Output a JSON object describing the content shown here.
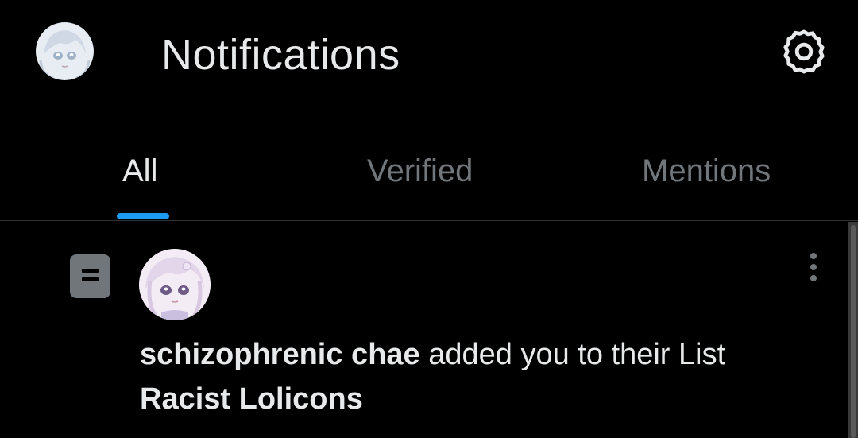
{
  "header": {
    "title": "Notifications",
    "settings_icon": "gear-icon",
    "avatar_icon": "avatar"
  },
  "tabs": [
    {
      "label": "All",
      "active": true
    },
    {
      "label": "Verified",
      "active": false
    },
    {
      "label": "Mentions",
      "active": false
    }
  ],
  "notification": {
    "type_icon": "list-icon",
    "user_name": "schizophrenic chae",
    "action": " added you to their List",
    "list_name": "Racist Lolicons",
    "more_icon": "more-vertical-icon"
  },
  "colors": {
    "background": "#000000",
    "text_primary": "#e7e9ea",
    "text_secondary": "#71767b",
    "accent": "#1d9bf0",
    "divider": "#2f3336"
  }
}
